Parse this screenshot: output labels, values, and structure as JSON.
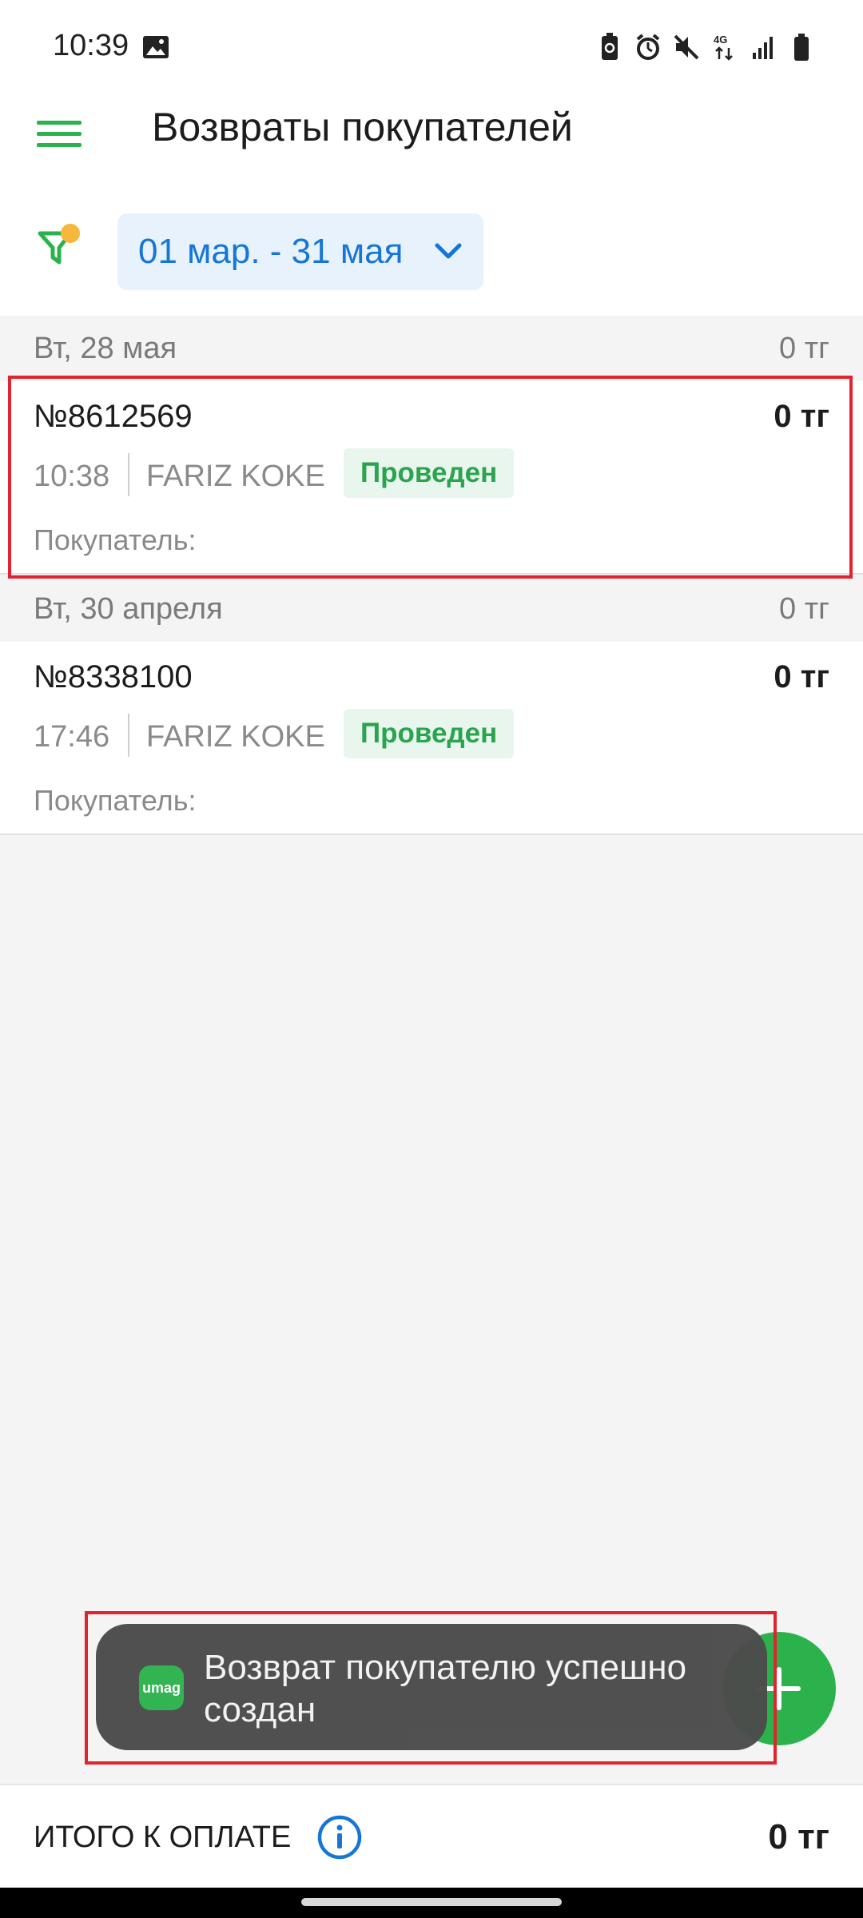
{
  "status": {
    "time": "10:39",
    "network": "4G"
  },
  "header": {
    "title": "Возвраты покупателей"
  },
  "filter": {
    "date_range": "01 мар. - 31 мая"
  },
  "groups": [
    {
      "date": "Вт, 28 мая",
      "sum": "0 тг",
      "items": [
        {
          "number": "№8612569",
          "amount": "0 тг",
          "time": "10:38",
          "user": "FARIZ KOKE",
          "status": "Проведен",
          "buyer": "Покупатель:"
        }
      ]
    },
    {
      "date": "Вт, 30 апреля",
      "sum": "0 тг",
      "items": [
        {
          "number": "№8338100",
          "amount": "0 тг",
          "time": "17:46",
          "user": "FARIZ KOKE",
          "status": "Проведен",
          "buyer": "Покупатель:"
        }
      ]
    }
  ],
  "toast": {
    "app_icon_text": "umag",
    "message": "Возврат покупателю успешно создан"
  },
  "footer": {
    "label": "ИТОГО К ОПЛАТЕ",
    "total": "0 тг"
  },
  "colors": {
    "accent_green": "#2bb24c",
    "link_blue": "#1676d6",
    "highlight_red": "#e0232e"
  }
}
